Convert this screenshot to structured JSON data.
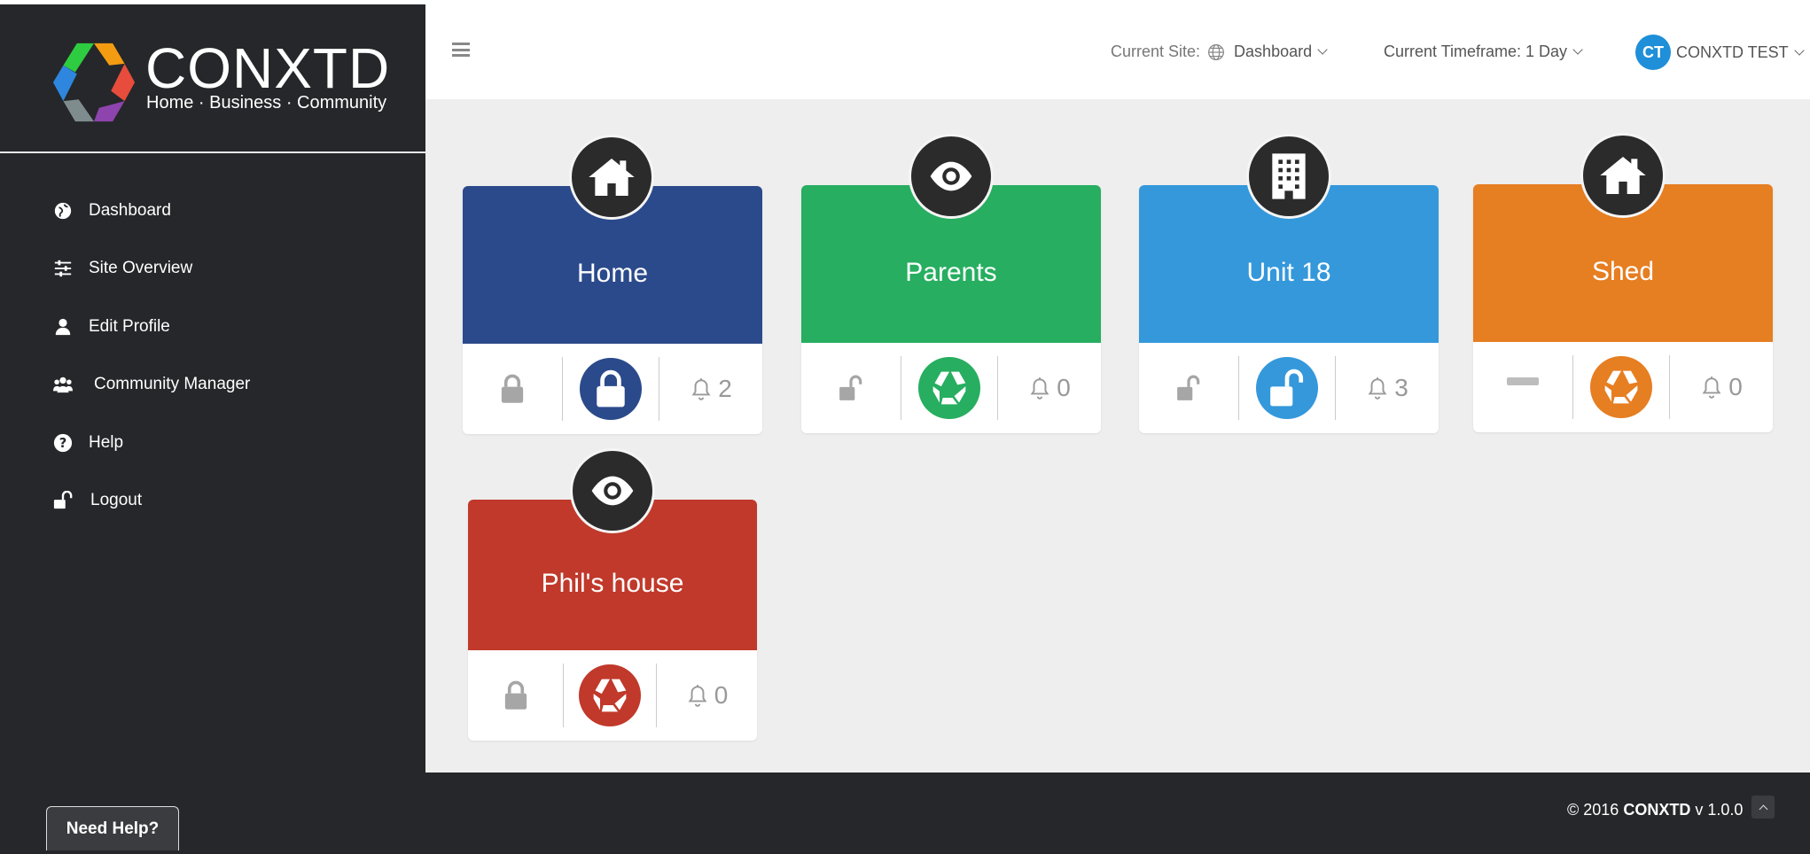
{
  "brand": {
    "name": "CONXTD",
    "tagline": "Home · Business · Community"
  },
  "sidebar": {
    "items": [
      {
        "label": "Dashboard",
        "icon": "globe-icon"
      },
      {
        "label": "Site Overview",
        "icon": "sliders-icon"
      },
      {
        "label": "Edit Profile",
        "icon": "user-icon"
      },
      {
        "label": "Community Manager",
        "icon": "users-icon"
      },
      {
        "label": "Help",
        "icon": "question-icon"
      },
      {
        "label": "Logout",
        "icon": "unlock-icon"
      }
    ]
  },
  "header": {
    "current_site_label": "Current Site:",
    "current_site_value": "Dashboard",
    "timeframe_label": "Current Timeframe: 1 Day",
    "user_initials": "CT",
    "user_name": "CONXTD TEST"
  },
  "cards": [
    {
      "title": "Home",
      "badge_icon": "house-icon",
      "color": "#2b4a8b",
      "lock_state": "locked",
      "status_icon": "lock-icon",
      "alerts": "2"
    },
    {
      "title": "Parents",
      "badge_icon": "eye-icon",
      "color": "#27ae60",
      "lock_state": "unlocked",
      "status_icon": "conxtd-logo-icon",
      "alerts": "0"
    },
    {
      "title": "Unit 18",
      "badge_icon": "building-icon",
      "color": "#3498db",
      "lock_state": "unlocked",
      "status_icon": "unlock-icon",
      "alerts": "3"
    },
    {
      "title": "Shed",
      "badge_icon": "house-icon",
      "color": "#e67e22",
      "lock_state": "unknown",
      "status_icon": "conxtd-logo-icon",
      "alerts": "0"
    },
    {
      "title": "Phil's house",
      "badge_icon": "eye-icon",
      "color": "#c0392b",
      "lock_state": "locked",
      "status_icon": "conxtd-logo-icon",
      "alerts": "0"
    }
  ],
  "footer": {
    "need_help": "Need Help?",
    "copyright_prefix": "© 2016",
    "copyright_brand": "CONXTD",
    "version": "v 1.0.0"
  }
}
